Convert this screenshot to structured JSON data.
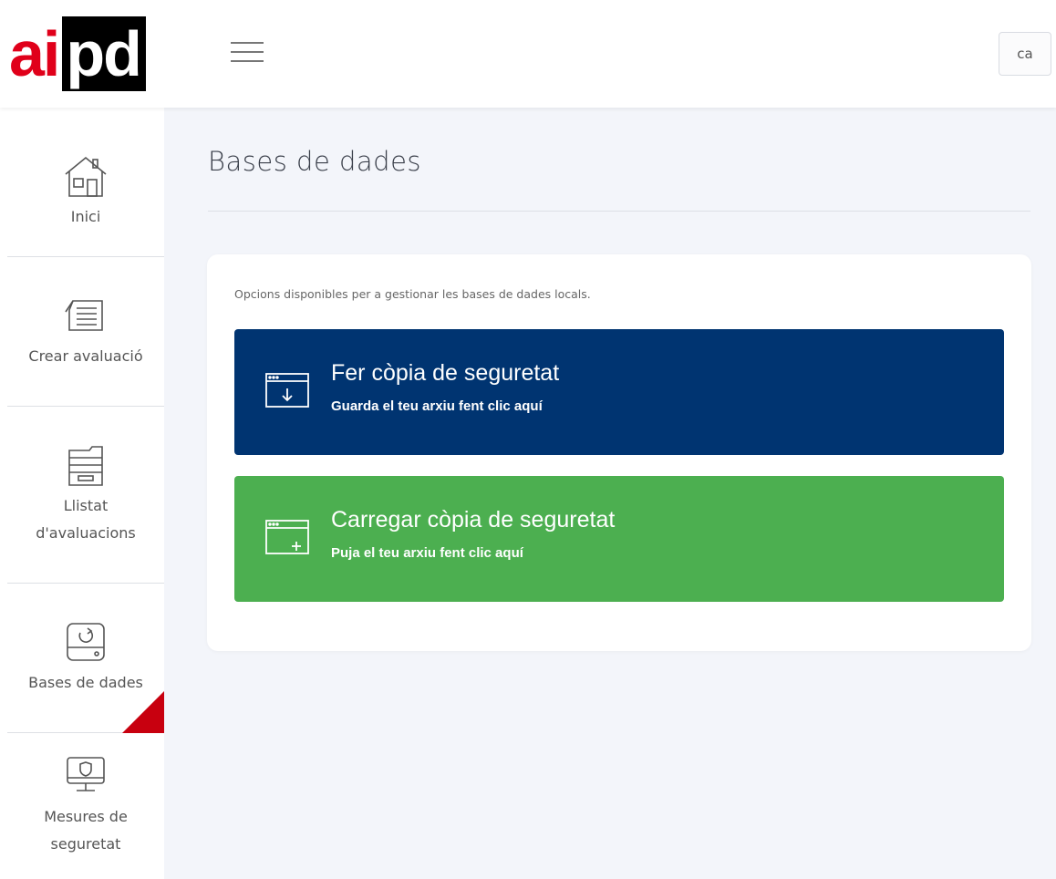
{
  "brand": {
    "logo_red": "ai",
    "logo_black": "pd",
    "red": "#e0001a",
    "dark": "#000000"
  },
  "header": {
    "language": "ca"
  },
  "sidebar": {
    "items": [
      {
        "label": "Inici",
        "icon": "house-icon"
      },
      {
        "label": "Crear avaluació",
        "icon": "document-list-icon"
      },
      {
        "label": "Llistat d'avaluacions",
        "icon": "archive-drawer-icon"
      },
      {
        "label": "Bases de dades",
        "icon": "database-sync-icon",
        "active": true
      },
      {
        "label": "Mesures de seguretat",
        "icon": "monitor-shield-icon"
      }
    ],
    "active_color": "#c8000f"
  },
  "main": {
    "title": "Bases de dades",
    "description": "Opcions disponibles per a gestionar les bases de dades locals.",
    "actions": [
      {
        "title": "Fer còpia de seguretat",
        "subtitle": "Guarda el teu arxiu fent clic aquí",
        "icon": "window-download-icon",
        "color": "#003471"
      },
      {
        "title": "Carregar còpia de seguretat",
        "subtitle": "Puja el teu arxiu fent clic aquí",
        "icon": "window-add-icon",
        "color": "#4caf50"
      }
    ]
  }
}
